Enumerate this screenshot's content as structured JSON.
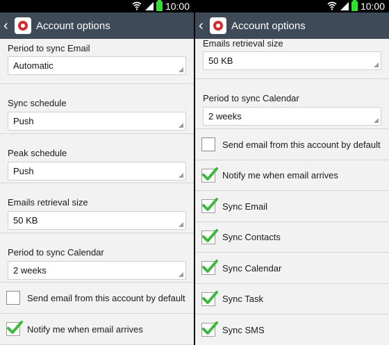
{
  "status_bar": {
    "time": "10:00"
  },
  "action_bar": {
    "title": "Account options"
  },
  "left_panel": {
    "dropdowns": [
      {
        "label": "Period to sync Email",
        "value": "Automatic"
      },
      {
        "label": "Sync schedule",
        "value": "Push"
      },
      {
        "label": "Peak schedule",
        "value": "Push"
      },
      {
        "label": "Emails retrieval size",
        "value": "50 KB"
      },
      {
        "label": "Period to sync Calendar",
        "value": "2 weeks"
      }
    ],
    "checkboxes": [
      {
        "label": "Send email from this account by default",
        "checked": false
      },
      {
        "label": "Notify me when email arrives",
        "checked": true
      }
    ]
  },
  "right_panel": {
    "dropdowns": [
      {
        "label": "Emails retrieval size",
        "value": "50 KB"
      },
      {
        "label": "Period to sync Calendar",
        "value": "2 weeks"
      }
    ],
    "checkboxes": [
      {
        "label": "Send email from this account by default",
        "checked": false
      },
      {
        "label": "Notify me when email arrives",
        "checked": true
      },
      {
        "label": "Sync Email",
        "checked": true
      },
      {
        "label": "Sync Contacts",
        "checked": true
      },
      {
        "label": "Sync Calendar",
        "checked": true
      },
      {
        "label": "Sync Task",
        "checked": true
      },
      {
        "label": "Sync SMS",
        "checked": true
      }
    ]
  },
  "colors": {
    "action_bar": "#3f4a58",
    "check_green": "#3cb83c",
    "background": "#f2f2f2"
  },
  "icons": {
    "back": "back-arrow-icon",
    "app": "email-app-icon",
    "wifi": "wifi-icon",
    "signal": "signal-icon",
    "battery": "battery-icon",
    "check": "checkmark-icon",
    "dropdown": "dropdown-caret-icon"
  }
}
